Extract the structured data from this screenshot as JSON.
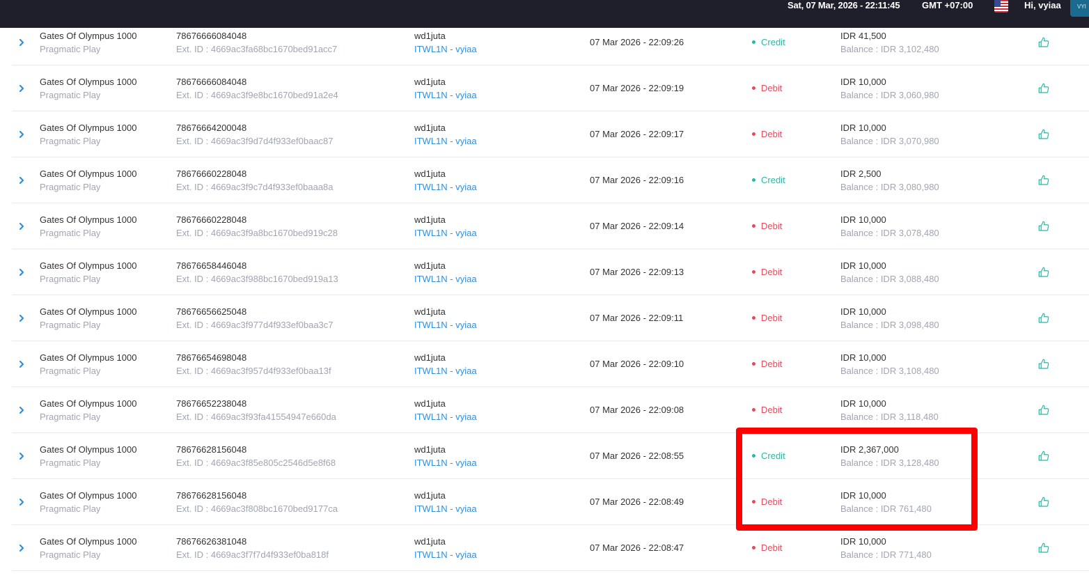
{
  "header": {
    "datetime": "Sat, 07 Mar, 2026 - 22:11:45",
    "timezone": "GMT +07:00",
    "greeting": "Hi, vyiaa",
    "avatar_text": "VYI"
  },
  "colors": {
    "credit": "#28b8a8",
    "debit": "#e8495a",
    "link": "#2f8fdc",
    "highlight": "#ff0000"
  },
  "rows": [
    {
      "game": "Gates Of Olympus 1000",
      "provider": "Pragmatic Play",
      "round_id": "78676666084048",
      "ext_id": "Ext. ID : 4669ac3fa68bc1670bed91acc7",
      "user": "wd1juta",
      "agent": "ITWL1N - vyiaa",
      "time": "07 Mar 2026 - 22:09:26",
      "type": "Credit",
      "amount": "IDR 41,500",
      "balance": "Balance : IDR 3,102,480"
    },
    {
      "game": "Gates Of Olympus 1000",
      "provider": "Pragmatic Play",
      "round_id": "78676666084048",
      "ext_id": "Ext. ID : 4669ac3f9e8bc1670bed91a2e4",
      "user": "wd1juta",
      "agent": "ITWL1N - vyiaa",
      "time": "07 Mar 2026 - 22:09:19",
      "type": "Debit",
      "amount": "IDR 10,000",
      "balance": "Balance : IDR 3,060,980"
    },
    {
      "game": "Gates Of Olympus 1000",
      "provider": "Pragmatic Play",
      "round_id": "78676664200048",
      "ext_id": "Ext. ID : 4669ac3f9d7d4f933ef0baac87",
      "user": "wd1juta",
      "agent": "ITWL1N - vyiaa",
      "time": "07 Mar 2026 - 22:09:17",
      "type": "Debit",
      "amount": "IDR 10,000",
      "balance": "Balance : IDR 3,070,980"
    },
    {
      "game": "Gates Of Olympus 1000",
      "provider": "Pragmatic Play",
      "round_id": "78676660228048",
      "ext_id": "Ext. ID : 4669ac3f9c7d4f933ef0baaa8a",
      "user": "wd1juta",
      "agent": "ITWL1N - vyiaa",
      "time": "07 Mar 2026 - 22:09:16",
      "type": "Credit",
      "amount": "IDR 2,500",
      "balance": "Balance : IDR 3,080,980"
    },
    {
      "game": "Gates Of Olympus 1000",
      "provider": "Pragmatic Play",
      "round_id": "78676660228048",
      "ext_id": "Ext. ID : 4669ac3f9a8bc1670bed919c28",
      "user": "wd1juta",
      "agent": "ITWL1N - vyiaa",
      "time": "07 Mar 2026 - 22:09:14",
      "type": "Debit",
      "amount": "IDR 10,000",
      "balance": "Balance : IDR 3,078,480"
    },
    {
      "game": "Gates Of Olympus 1000",
      "provider": "Pragmatic Play",
      "round_id": "78676658446048",
      "ext_id": "Ext. ID : 4669ac3f988bc1670bed919a13",
      "user": "wd1juta",
      "agent": "ITWL1N - vyiaa",
      "time": "07 Mar 2026 - 22:09:13",
      "type": "Debit",
      "amount": "IDR 10,000",
      "balance": "Balance : IDR 3,088,480"
    },
    {
      "game": "Gates Of Olympus 1000",
      "provider": "Pragmatic Play",
      "round_id": "78676656625048",
      "ext_id": "Ext. ID : 4669ac3f977d4f933ef0baa3c7",
      "user": "wd1juta",
      "agent": "ITWL1N - vyiaa",
      "time": "07 Mar 2026 - 22:09:11",
      "type": "Debit",
      "amount": "IDR 10,000",
      "balance": "Balance : IDR 3,098,480"
    },
    {
      "game": "Gates Of Olympus 1000",
      "provider": "Pragmatic Play",
      "round_id": "78676654698048",
      "ext_id": "Ext. ID : 4669ac3f957d4f933ef0baa13f",
      "user": "wd1juta",
      "agent": "ITWL1N - vyiaa",
      "time": "07 Mar 2026 - 22:09:10",
      "type": "Debit",
      "amount": "IDR 10,000",
      "balance": "Balance : IDR 3,108,480"
    },
    {
      "game": "Gates Of Olympus 1000",
      "provider": "Pragmatic Play",
      "round_id": "78676652238048",
      "ext_id": "Ext. ID : 4669ac3f93fa41554947e660da",
      "user": "wd1juta",
      "agent": "ITWL1N - vyiaa",
      "time": "07 Mar 2026 - 22:09:08",
      "type": "Debit",
      "amount": "IDR 10,000",
      "balance": "Balance : IDR 3,118,480"
    },
    {
      "game": "Gates Of Olympus 1000",
      "provider": "Pragmatic Play",
      "round_id": "78676628156048",
      "ext_id": "Ext. ID : 4669ac3f85e805c2546d5e8f68",
      "user": "wd1juta",
      "agent": "ITWL1N - vyiaa",
      "time": "07 Mar 2026 - 22:08:55",
      "type": "Credit",
      "amount": "IDR 2,367,000",
      "balance": "Balance : IDR 3,128,480"
    },
    {
      "game": "Gates Of Olympus 1000",
      "provider": "Pragmatic Play",
      "round_id": "78676628156048",
      "ext_id": "Ext. ID : 4669ac3f808bc1670bed9177ca",
      "user": "wd1juta",
      "agent": "ITWL1N - vyiaa",
      "time": "07 Mar 2026 - 22:08:49",
      "type": "Debit",
      "amount": "IDR 10,000",
      "balance": "Balance : IDR 761,480"
    },
    {
      "game": "Gates Of Olympus 1000",
      "provider": "Pragmatic Play",
      "round_id": "78676626381048",
      "ext_id": "Ext. ID : 4669ac3f7f7d4f933ef0ba818f",
      "user": "wd1juta",
      "agent": "ITWL1N - vyiaa",
      "time": "07 Mar 2026 - 22:08:47",
      "type": "Debit",
      "amount": "IDR 10,000",
      "balance": "Balance : IDR 771,480"
    }
  ]
}
